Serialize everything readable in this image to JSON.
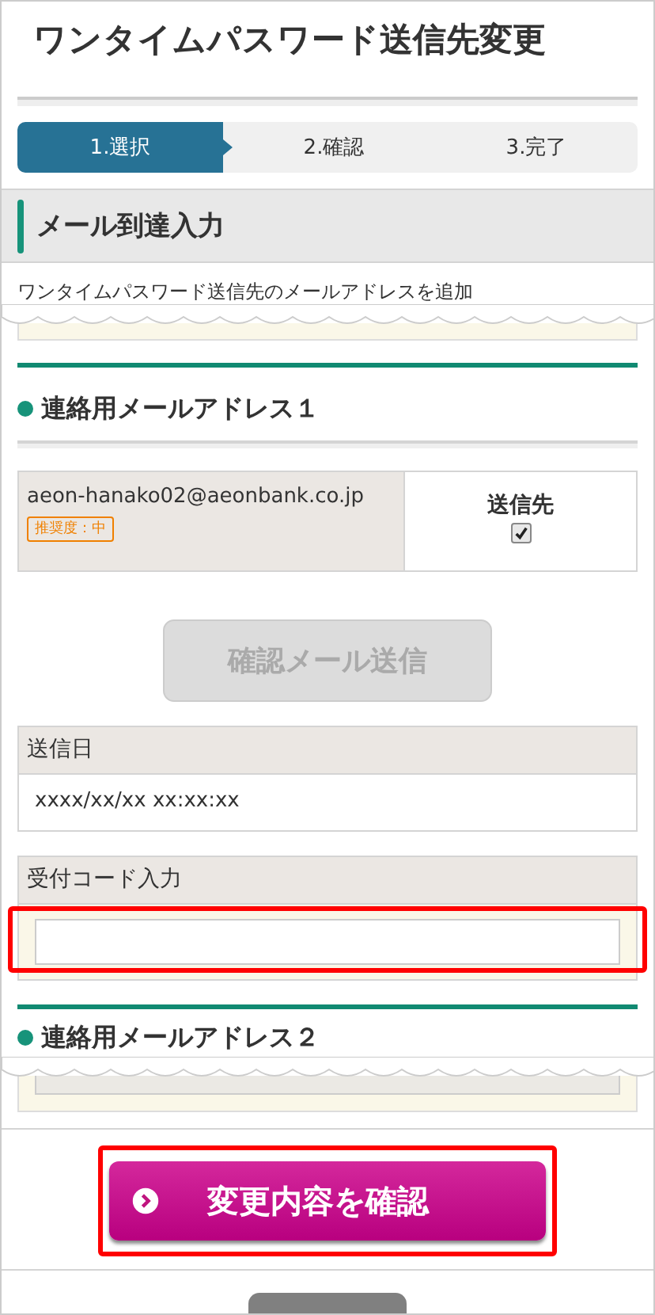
{
  "page_title": "ワンタイムパスワード送信先変更",
  "steps": [
    {
      "label": "1.選択",
      "selected": true
    },
    {
      "label": "2.確認",
      "selected": false
    },
    {
      "label": "3.完了",
      "selected": false
    }
  ],
  "section_title": "メール到達入力",
  "intro_text": "ワンタイムパスワード送信先のメールアドレスを追加",
  "address_1": {
    "heading": "連絡用メールアドレス１",
    "email": "aeon-hanako02@aeonbank.co.jp",
    "badge": "推奨度：中",
    "destination_label": "送信先",
    "destination_checked": true,
    "send_button": {
      "label": "確認メール送信",
      "disabled": true
    },
    "sent_date": {
      "label": "送信日",
      "value": "xxxx/xx/xx xx:xx:xx"
    },
    "code_input": {
      "label": "受付コード入力",
      "highlighted": true
    }
  },
  "address_2": {
    "heading": "連絡用メールアドレス２"
  },
  "confirm_button": {
    "label": "変更内容を確認",
    "highlighted": true
  }
}
